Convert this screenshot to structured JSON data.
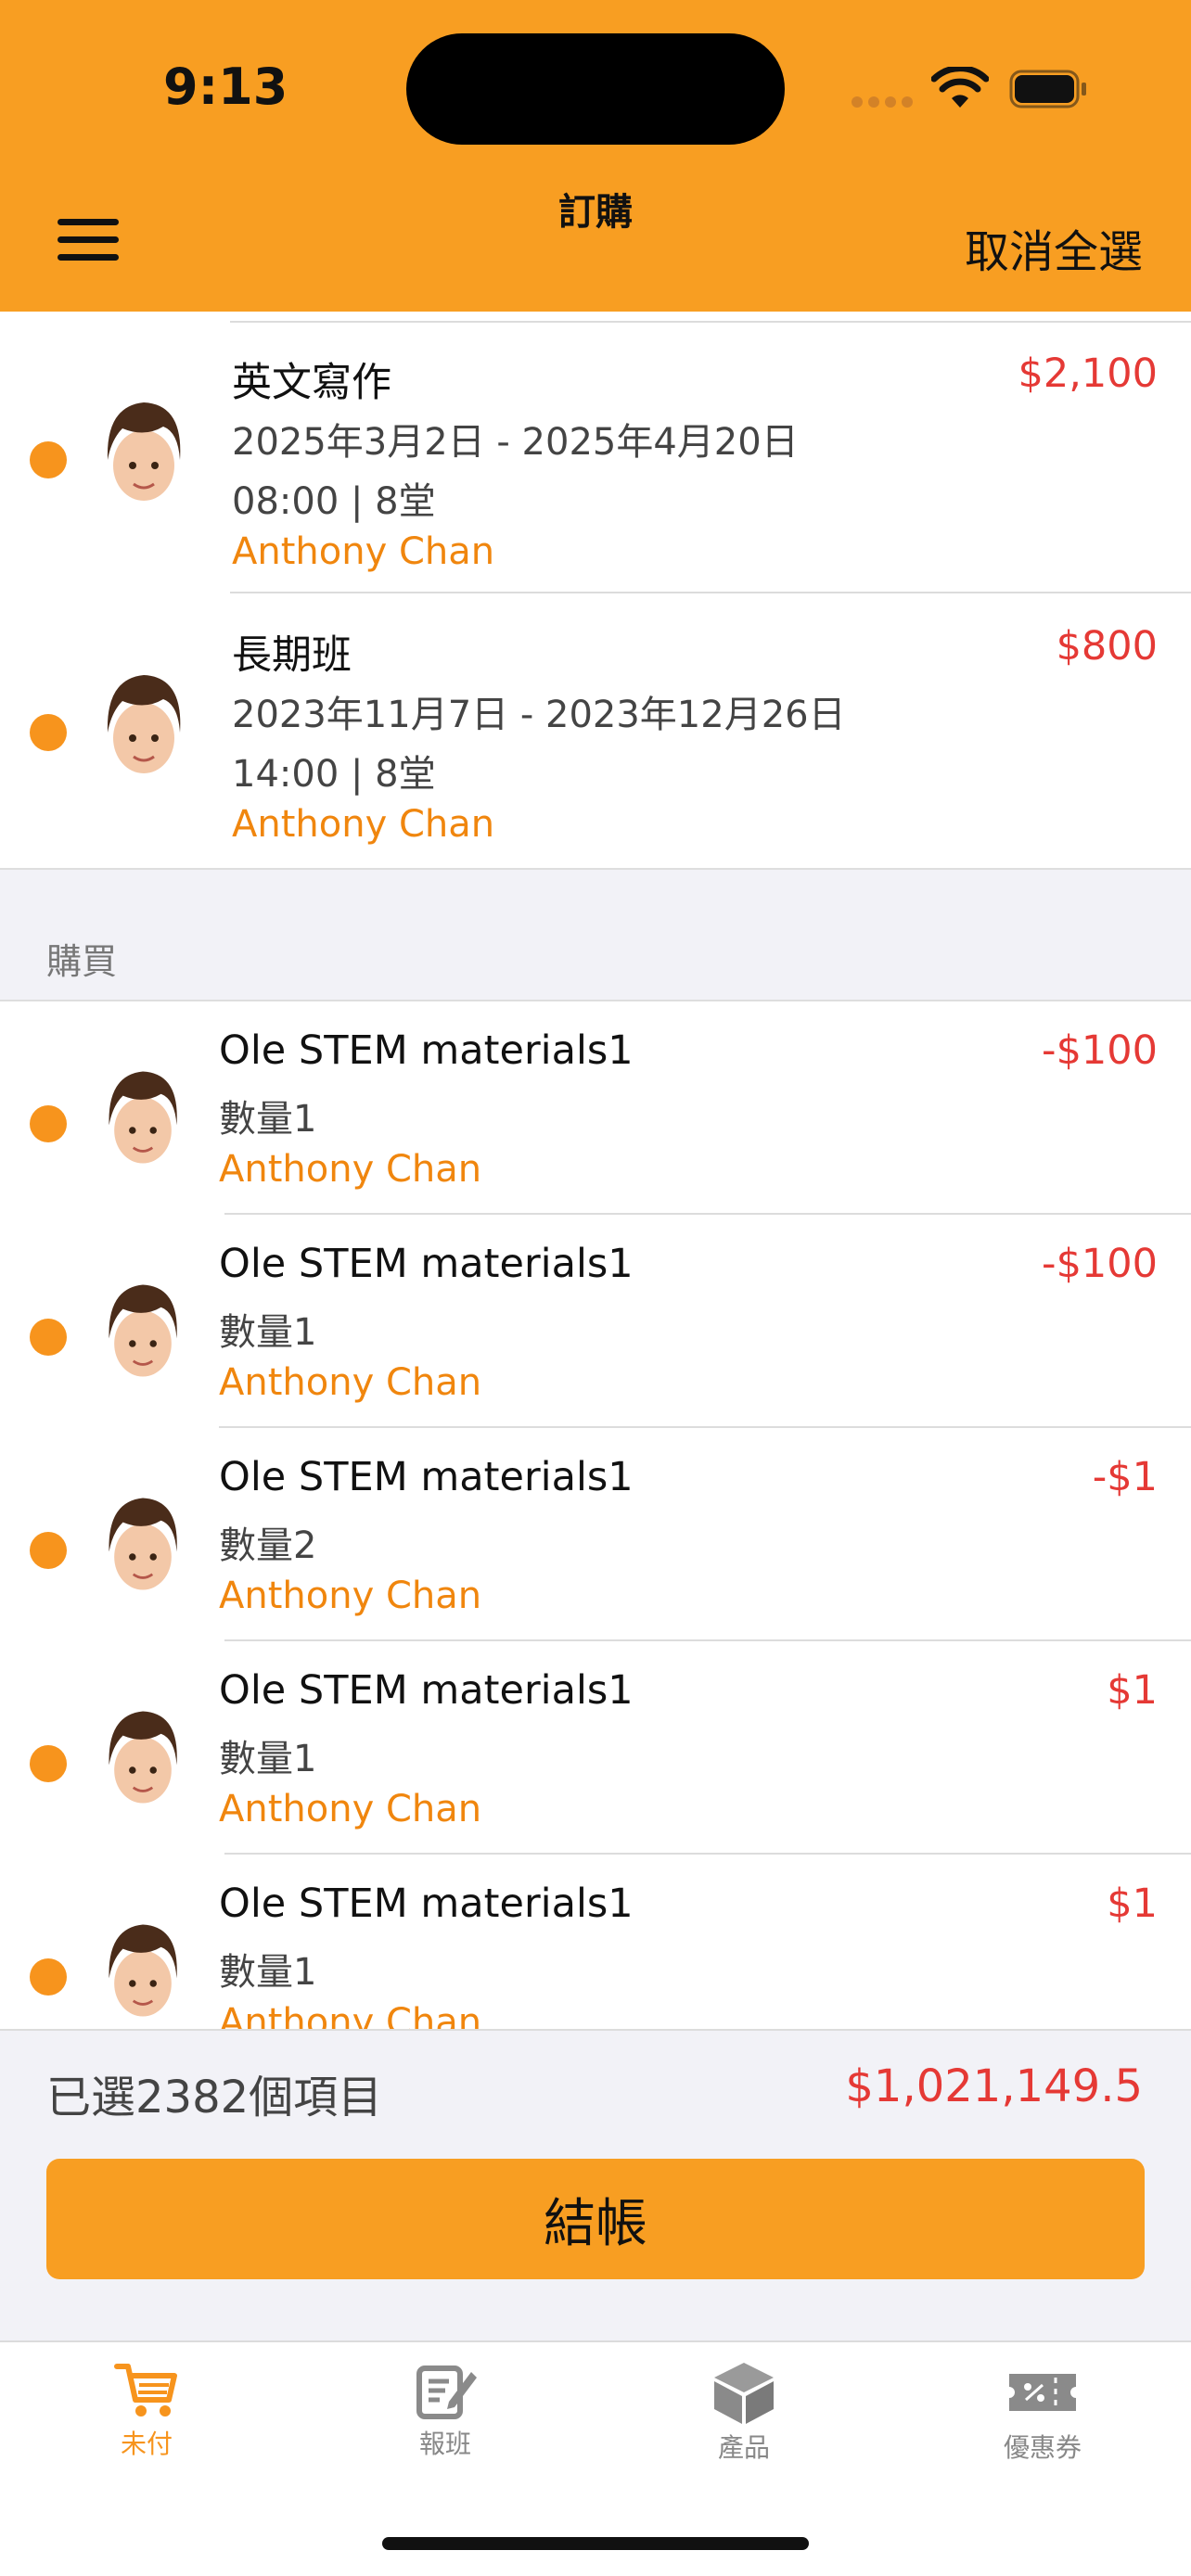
{
  "status_bar": {
    "time": "9:13"
  },
  "nav": {
    "title": "訂購",
    "deselect_all": "取消全選"
  },
  "course_items": [
    {
      "title": "英文寫作",
      "date_range": "2025年3月2日 - 2025年4月20日",
      "time_info": "08:00 | 8堂",
      "student": "Anthony Chan",
      "price": "$2,100"
    },
    {
      "title": "長期班",
      "date_range": "2023年11月7日 - 2023年12月26日",
      "time_info": "14:00 | 8堂",
      "student": "Anthony Chan",
      "price": "$800"
    }
  ],
  "purchase_section": {
    "title": "購買",
    "items": [
      {
        "name": "Ole STEM materials1",
        "quantity": "數量1",
        "student": "Anthony Chan",
        "price": "-$100"
      },
      {
        "name": "Ole STEM materials1",
        "quantity": "數量1",
        "student": "Anthony Chan",
        "price": "-$100"
      },
      {
        "name": "Ole STEM materials1",
        "quantity": "數量2",
        "student": "Anthony Chan",
        "price": "-$1"
      },
      {
        "name": "Ole STEM materials1",
        "quantity": "數量1",
        "student": "Anthony Chan",
        "price": "$1"
      },
      {
        "name": "Ole STEM materials1",
        "quantity": "數量1",
        "student": "Anthony Chan",
        "price": "$1"
      }
    ]
  },
  "summary": {
    "selected_text": "已選2382個項目",
    "total": "$1,021,149.5",
    "checkout_label": "結帳"
  },
  "tabs": [
    {
      "label": "未付",
      "icon": "cart-icon",
      "active": true
    },
    {
      "label": "報班",
      "icon": "edit-icon",
      "active": false
    },
    {
      "label": "產品",
      "icon": "box-icon",
      "active": false
    },
    {
      "label": "優惠券",
      "icon": "coupon-icon",
      "active": false
    }
  ],
  "colors": {
    "accent": "#F89E22",
    "price": "#E53935",
    "student": "#F0860E"
  }
}
